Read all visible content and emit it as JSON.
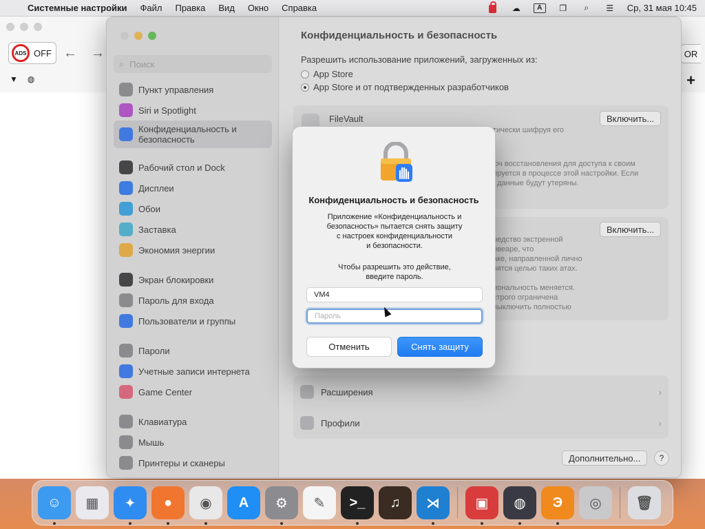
{
  "menubar": {
    "app_name": "Системные настройки",
    "items": [
      "Файл",
      "Правка",
      "Вид",
      "Окно",
      "Справка"
    ],
    "input_indicator": "A",
    "datetime": "Ср, 31 мая  10:45"
  },
  "browser": {
    "ads_label": "ADS",
    "ads_state": "OFF",
    "right_fragment": "OR"
  },
  "sidebar": {
    "search_placeholder": "Поиск",
    "items": [
      {
        "label": "Пункт управления",
        "icon": "control-center-icon",
        "color": "#8e8e93"
      },
      {
        "label": "Siri и Spotlight",
        "icon": "siri-icon",
        "color": "#b94fd1"
      },
      {
        "label": "Конфиденциальность и безопасность",
        "icon": "hand-icon",
        "color": "#3478f6"
      },
      {
        "label": "Рабочий стол и Dock",
        "icon": "dock-icon",
        "color": "#3a3a3c"
      },
      {
        "label": "Дисплеи",
        "icon": "sun-icon",
        "color": "#2f7cf6"
      },
      {
        "label": "Обои",
        "icon": "wallpaper-icon",
        "color": "#35a7e8"
      },
      {
        "label": "Заставка",
        "icon": "screensaver-icon",
        "color": "#4bb9d9"
      },
      {
        "label": "Экономия энергии",
        "icon": "bulb-icon",
        "color": "#f3b33d"
      },
      {
        "label": "Экран блокировки",
        "icon": "lock-icon",
        "color": "#3a3a3c"
      },
      {
        "label": "Пароль для входа",
        "icon": "password-lock-icon",
        "color": "#8e8e93"
      },
      {
        "label": "Пользователи и группы",
        "icon": "users-icon",
        "color": "#3478f6"
      },
      {
        "label": "Пароли",
        "icon": "key-icon",
        "color": "#8e8e93"
      },
      {
        "label": "Учетные записи интернета",
        "icon": "at-icon",
        "color": "#3478f6"
      },
      {
        "label": "Game Center",
        "icon": "game-center-icon",
        "color": "#e8657a"
      },
      {
        "label": "Клавиатура",
        "icon": "keyboard-icon",
        "color": "#8e8e93"
      },
      {
        "label": "Мышь",
        "icon": "mouse-icon",
        "color": "#8e8e93"
      },
      {
        "label": "Принтеры и сканеры",
        "icon": "printer-icon",
        "color": "#8e8e93"
      }
    ]
  },
  "main": {
    "title": "Конфиденциальность и безопасность",
    "allow_label": "Разрешить использование приложений, загруженных из:",
    "radio_1": "App Store",
    "radio_2": "App Store и от подтвержденных разработчиков",
    "filevault": "FileVault",
    "enable_1": "Включить...",
    "enable_2": "Включить...",
    "fv_desc_a": "тически шифруя его",
    "fv_desc_b": "юч восстановления для доступа к своим\nируется в процессе этой настройки. Если\n, данные будут утеряны.",
    "lockdown_desc": "редство экстренной\nрвеаре, что\nаке, направленной лично\nвятся целью таких атах.",
    "lockdown_desc_b": "иональность меняется.\nстрого ограничена\nвыключить полностью",
    "extensions": "Расширения",
    "profiles": "Профили",
    "advanced": "Дополнительно...",
    "help": "?"
  },
  "dialog": {
    "title": "Конфиденциальность и безопасность",
    "message": "Приложение «Конфиденциальность и\nбезопасность» пытается снять защиту\nс настроек конфиденциальности\nи безопасности.",
    "message2": "Чтобы разрешить это действие,\nвведите пароль.",
    "username": "VM4",
    "password_placeholder": "Пароль",
    "cancel": "Отменить",
    "unlock": "Снять защиту"
  },
  "dock": [
    {
      "name": "finder-icon",
      "color": "#3c9af0",
      "glyph": "☺",
      "running": true
    },
    {
      "name": "launchpad-icon",
      "color": "#e9e9ee",
      "glyph": "▦",
      "running": false
    },
    {
      "name": "safari-icon",
      "color": "#2f8cf1",
      "glyph": "✦",
      "running": true
    },
    {
      "name": "firefox-icon",
      "color": "#f0762f",
      "glyph": "●",
      "running": true
    },
    {
      "name": "chrome-icon",
      "color": "#e8e8e8",
      "glyph": "◉",
      "running": true
    },
    {
      "name": "app-store-icon",
      "color": "#1f8ef5",
      "glyph": "A",
      "running": false
    },
    {
      "name": "system-settings-icon",
      "color": "#8b8b90",
      "glyph": "⚙",
      "running": true
    },
    {
      "name": "textedit-icon",
      "color": "#f4f4f4",
      "glyph": "✎",
      "running": false
    },
    {
      "name": "terminal-icon",
      "color": "#222",
      "glyph": ">_",
      "running": true
    },
    {
      "name": "garageband-icon",
      "color": "#3a2c22",
      "glyph": "♫",
      "running": false
    },
    {
      "name": "vscode-icon",
      "color": "#1f7fd1",
      "glyph": "⋊",
      "running": true
    },
    {
      "name": "parallels-icon",
      "color": "#d83c3c",
      "glyph": "▣",
      "running": true
    },
    {
      "name": "network-icon",
      "color": "#3a3a44",
      "glyph": "◍",
      "running": true
    },
    {
      "name": "vpn-icon",
      "color": "#f08a1e",
      "glyph": "Э",
      "running": true
    },
    {
      "name": "preview-icon",
      "color": "#c9c9cc",
      "glyph": "◎",
      "running": false
    },
    {
      "name": "trash-icon",
      "color": "#dcdde0",
      "glyph": "🗑",
      "running": false
    }
  ]
}
